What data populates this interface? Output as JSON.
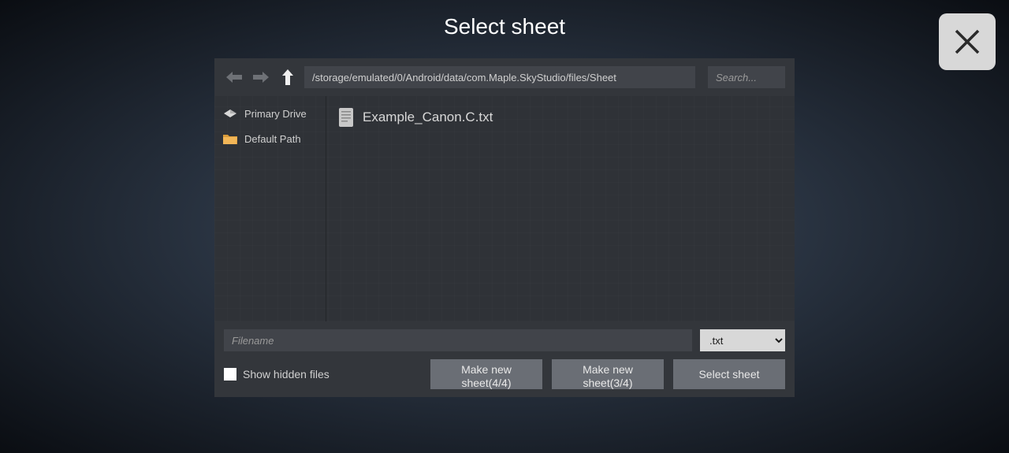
{
  "title": "Select sheet",
  "toolbar": {
    "path": "/storage/emulated/0/Android/data/com.Maple.SkyStudio/files/Sheet",
    "search_placeholder": "Search..."
  },
  "sidebar": {
    "items": [
      {
        "label": "Primary Drive"
      },
      {
        "label": "Default Path"
      }
    ]
  },
  "files": [
    {
      "name": "Example_Canon.C.txt"
    }
  ],
  "filename_placeholder": "Filename",
  "extension": ".txt",
  "show_hidden_label": "Show hidden files",
  "buttons": {
    "make44": "Make new sheet(4/4)",
    "make34": "Make new sheet(3/4)",
    "select": "Select sheet"
  }
}
